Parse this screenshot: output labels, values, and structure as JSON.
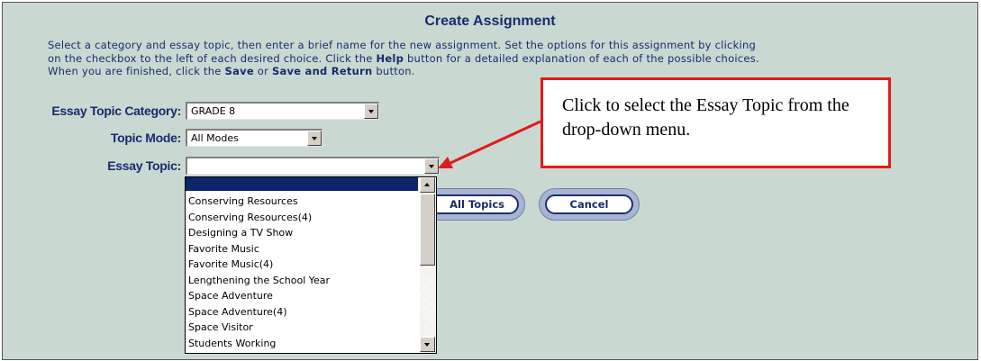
{
  "page": {
    "title": "Create Assignment",
    "instructions": {
      "t1": "Select a category and essay topic, then enter a brief name for the new assignment. Set the options for this assignment by clicking on the checkbox to the left of each desired choice. Click the ",
      "b1": "Help",
      "t2": " button for a detailed explanation of each of the possible choices. When you are finished, click the ",
      "b2": "Save",
      "t3": " or ",
      "b3": "Save and Return",
      "t4": " button."
    }
  },
  "form": {
    "category": {
      "label": "Essay Topic Category:",
      "value": "GRADE 8"
    },
    "mode": {
      "label": "Topic Mode:",
      "value": "All Modes"
    },
    "topic": {
      "label": "Essay Topic:",
      "value": "",
      "options": [
        "Conserving Resources",
        "Conserving Resources(4)",
        "Designing a TV Show",
        "Favorite Music",
        "Favorite Music(4)",
        "Lengthening the School Year",
        "Space Adventure",
        "Space Adventure(4)",
        "Space Visitor",
        "Students Working"
      ]
    }
  },
  "buttons": {
    "all_topics": "All Topics",
    "cancel": "Cancel"
  },
  "callout": {
    "text": "Click to select the Essay Topic from the drop-down menu.",
    "color": "#e31a1a"
  },
  "colors": {
    "panel_bg": "#c9d9d2",
    "label_text": "#1b2a6b",
    "selection": "#0b246a"
  },
  "icons": [
    "chevron-down-icon",
    "scroll-up-icon",
    "scroll-down-icon"
  ]
}
